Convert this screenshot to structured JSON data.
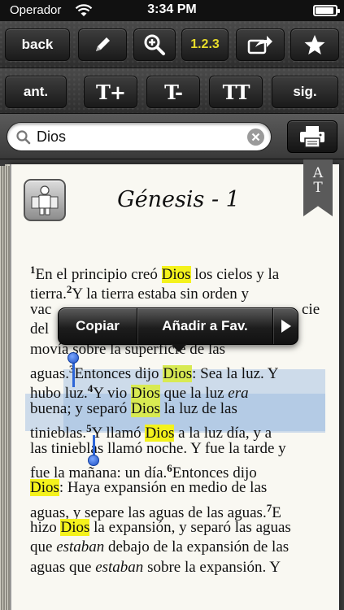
{
  "status_bar": {
    "carrier": "Operador",
    "time": "3:34 PM"
  },
  "toolbar_top": {
    "back_label": "back",
    "edit_icon": "pencil-icon",
    "zoom_icon": "zoom-in-icon",
    "verse_numbers_label": "1.2.3",
    "share_icon": "share-icon",
    "favorite_icon": "star-icon"
  },
  "toolbar_bottom": {
    "prev_label": "ant.",
    "font_increase_label": "T+",
    "font_decrease_label": "T-",
    "font_style_label": "TT",
    "next_label": "sig."
  },
  "search": {
    "value": "Dios",
    "print_icon": "printer-icon"
  },
  "page": {
    "title": "Génesis - 1",
    "ribbon_label": "AT",
    "ribbon_top": "A",
    "ribbon_bottom": "T"
  },
  "popup": {
    "copy_label": "Copiar",
    "add_favorite_label": "Añadir a Fav.",
    "more_icon": "play-arrow-icon"
  },
  "text_lines": [
    "1En el principio creó Dios los cielos y la",
    "tierra. 2Y la tierra estaba sin orden y",
    "vacía, y las tinieblas estaban sobre la faz del abismo, y el Espíritu de Dios se movía sobre la superficie de las",
    "aguas. 3Entonces dijo Dios: Sea la luz. Y",
    "hubo luz. 4Y vio Dios que la luz era",
    "buena; y separó Dios la luz de las",
    "tinieblas. 5Y llamó Dios a la luz día, y a",
    "las tinieblas llamó noche. Y fue la tarde y",
    "fue la mañana: un día. 6Entonces dijo",
    "Dios: Haya expansión en medio de las",
    "aguas, y separe las aguas de las aguas. 7E",
    "hizo Dios la expansión, y separó las aguas",
    "que estaban debajo de la expansión de las",
    "aguas que estaban sobre la expansión. Y"
  ],
  "text": {
    "v1": "1",
    "l1a": "En el principio creó ",
    "dios": "Dios",
    "l1b": " los cielos y la",
    "l2a": "tierra.",
    "v2": "2",
    "l2b": "Y la tierra estaba sin orden y",
    "l3a": "vac",
    "l3b": "cie",
    "l4a": "del",
    "l5a": "movía sobre la superficie de las",
    "l6a": "aguas.",
    "v3": "3",
    "l6b": "Entonces dijo ",
    "l6c": ": Sea la luz. Y",
    "l7a": "hubo luz.",
    "v4": "4",
    "l7b": "Y vio ",
    "l7c": " que la luz ",
    "l7d": "era",
    "l8a": "buena; y separó ",
    "l8b": " la luz de las",
    "l9a": "tinieblas.",
    "v5": "5",
    "l9b": "Y llamó ",
    "l9c": " a la luz día, y a",
    "l10": "las tinieblas llamó noche. Y fue la tarde y",
    "l11a": "fue la mañana: un día.",
    "v6": "6",
    "l11b": "Entonces dijo",
    "l12b": ": Haya expansión en medio de las",
    "l13a": "aguas, y separe las aguas de las aguas.",
    "v7": "7",
    "l13b": "E",
    "l14a": "hizo ",
    "l14b": " la expansión, y separó las aguas",
    "l15a": "que ",
    "estaban": "estaban",
    "l15b": " debajo de la expansión de las",
    "l16a": "aguas que ",
    "l16b": " sobre la expansión.  Y"
  },
  "colors": {
    "highlight": "#f4f21c",
    "selection": "#bcd1ec",
    "handle": "#2d66d8",
    "verse_button_text": "#e8dd2a"
  }
}
